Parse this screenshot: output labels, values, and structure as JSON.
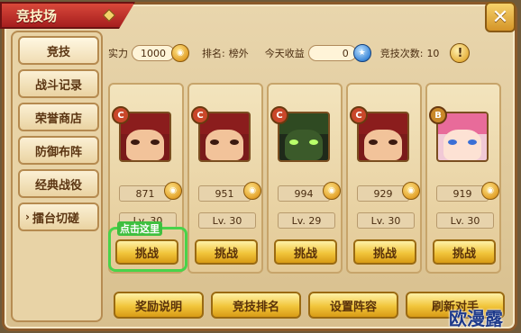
{
  "title": "竞技场",
  "close_label": "✕",
  "sidebar": {
    "items": [
      {
        "label": "竞技",
        "active": true
      },
      {
        "label": "战斗记录",
        "active": false
      },
      {
        "label": "荣誉商店",
        "active": false
      },
      {
        "label": "防御布阵",
        "active": false
      },
      {
        "label": "经典战役",
        "active": false
      },
      {
        "label": "擂台切磋",
        "active": false,
        "chevron": "›"
      }
    ]
  },
  "stats": {
    "power_label": "实力",
    "power_value": "1000",
    "rank_label": "排名:",
    "rank_value": "榜外",
    "income_label": "今天收益",
    "income_value": "0",
    "attempts_label": "竞技次数:",
    "attempts_value": "10",
    "warn_icon": "!"
  },
  "opponents": [
    {
      "grade": "C",
      "grade_color": "#c9472a",
      "power": "871",
      "level": "Lv. 30",
      "challenge": "挑战",
      "portrait": "red-hat"
    },
    {
      "grade": "C",
      "grade_color": "#c9472a",
      "power": "951",
      "level": "Lv. 30",
      "challenge": "挑战",
      "portrait": "red-hat"
    },
    {
      "grade": "C",
      "grade_color": "#c9472a",
      "power": "994",
      "level": "Lv. 29",
      "challenge": "挑战",
      "portrait": "dark-green"
    },
    {
      "grade": "C",
      "grade_color": "#c9472a",
      "power": "929",
      "level": "Lv. 30",
      "challenge": "挑战",
      "portrait": "red-hat"
    },
    {
      "grade": "B",
      "grade_color": "#c9882a",
      "power": "919",
      "level": "Lv. 30",
      "challenge": "挑战",
      "portrait": "pink-hair"
    }
  ],
  "click_hint": "点击这里",
  "bottom_buttons": [
    "奖励说明",
    "竞技排名",
    "设置阵容",
    "刷新对手"
  ],
  "watermark": "欧漫露",
  "colors": {
    "accent": "#f1c53b",
    "frame": "#8b5a2b",
    "title_red": "#a51e1e",
    "hint_green": "#49d34a"
  }
}
